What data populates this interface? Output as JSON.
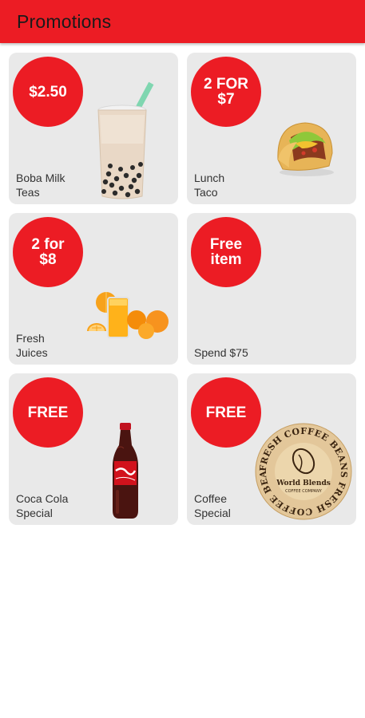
{
  "appbar": {
    "title": "Promotions"
  },
  "promotions": [
    {
      "badge": "$2.50",
      "label": "Boba Milk\nTeas",
      "image": "boba-milk-tea-image"
    },
    {
      "badge": "2 FOR\n$7",
      "label": "Lunch\nTaco",
      "image": "taco-image"
    },
    {
      "badge": "2 for\n$8",
      "label": "Fresh\nJuices",
      "image": "orange-juice-image"
    },
    {
      "badge": "Free\nitem",
      "label": "Spend $75",
      "image": ""
    },
    {
      "badge": "FREE",
      "label": "Coca Cola\nSpecial",
      "image": "coca-cola-bottle-image"
    },
    {
      "badge": "FREE",
      "label": "Coffee\nSpecial",
      "image": "coffee-beans-stamp-image"
    }
  ],
  "coffee_stamp": {
    "ring_text": "FRESH COFFEE BEANS FRESH COFFEE BEANS",
    "brand": "World Blends",
    "sub": "COFFEE COMPANY"
  },
  "colors": {
    "accent": "#ec1c24",
    "card": "#e9e9e9",
    "background": "#ffffff"
  }
}
